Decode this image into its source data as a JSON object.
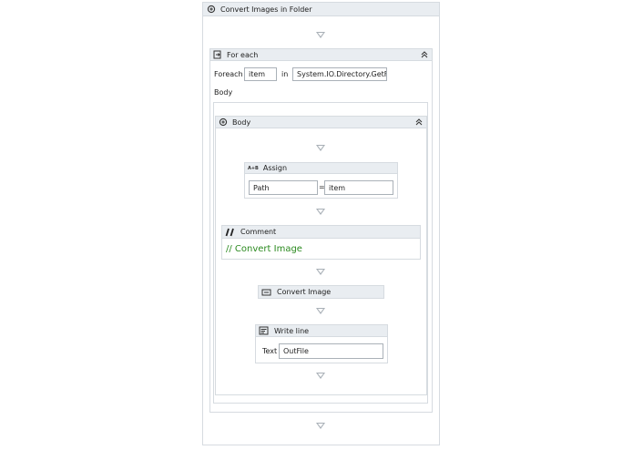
{
  "sequence": {
    "title": "Convert Images in Folder",
    "icon": "sequence-icon"
  },
  "foreach": {
    "title": "For each",
    "icon": "foreach-icon",
    "foreach_label": "Foreach",
    "item_value": "item",
    "in_label": "in",
    "source_value": "System.IO.Directory.GetFil",
    "body_label": "Body",
    "collapse_icon": "double-chevron-up-icon"
  },
  "body": {
    "title": "Body",
    "icon": "sequence-icon",
    "collapse_icon": "double-chevron-up-icon"
  },
  "assign": {
    "title": "Assign",
    "icon": "assign-icon",
    "icon_text": "A+B",
    "to_value": "Path",
    "equals": "=",
    "value_value": "item"
  },
  "comment": {
    "title": "Comment",
    "icon": "comment-icon",
    "text": "// Convert Image",
    "text_color": "#2b8a1f"
  },
  "convert": {
    "title": "Convert Image",
    "icon": "convert-image-icon"
  },
  "writeline": {
    "title": "Write line",
    "icon": "write-line-icon",
    "text_label": "Text",
    "text_value": "OutFile"
  }
}
